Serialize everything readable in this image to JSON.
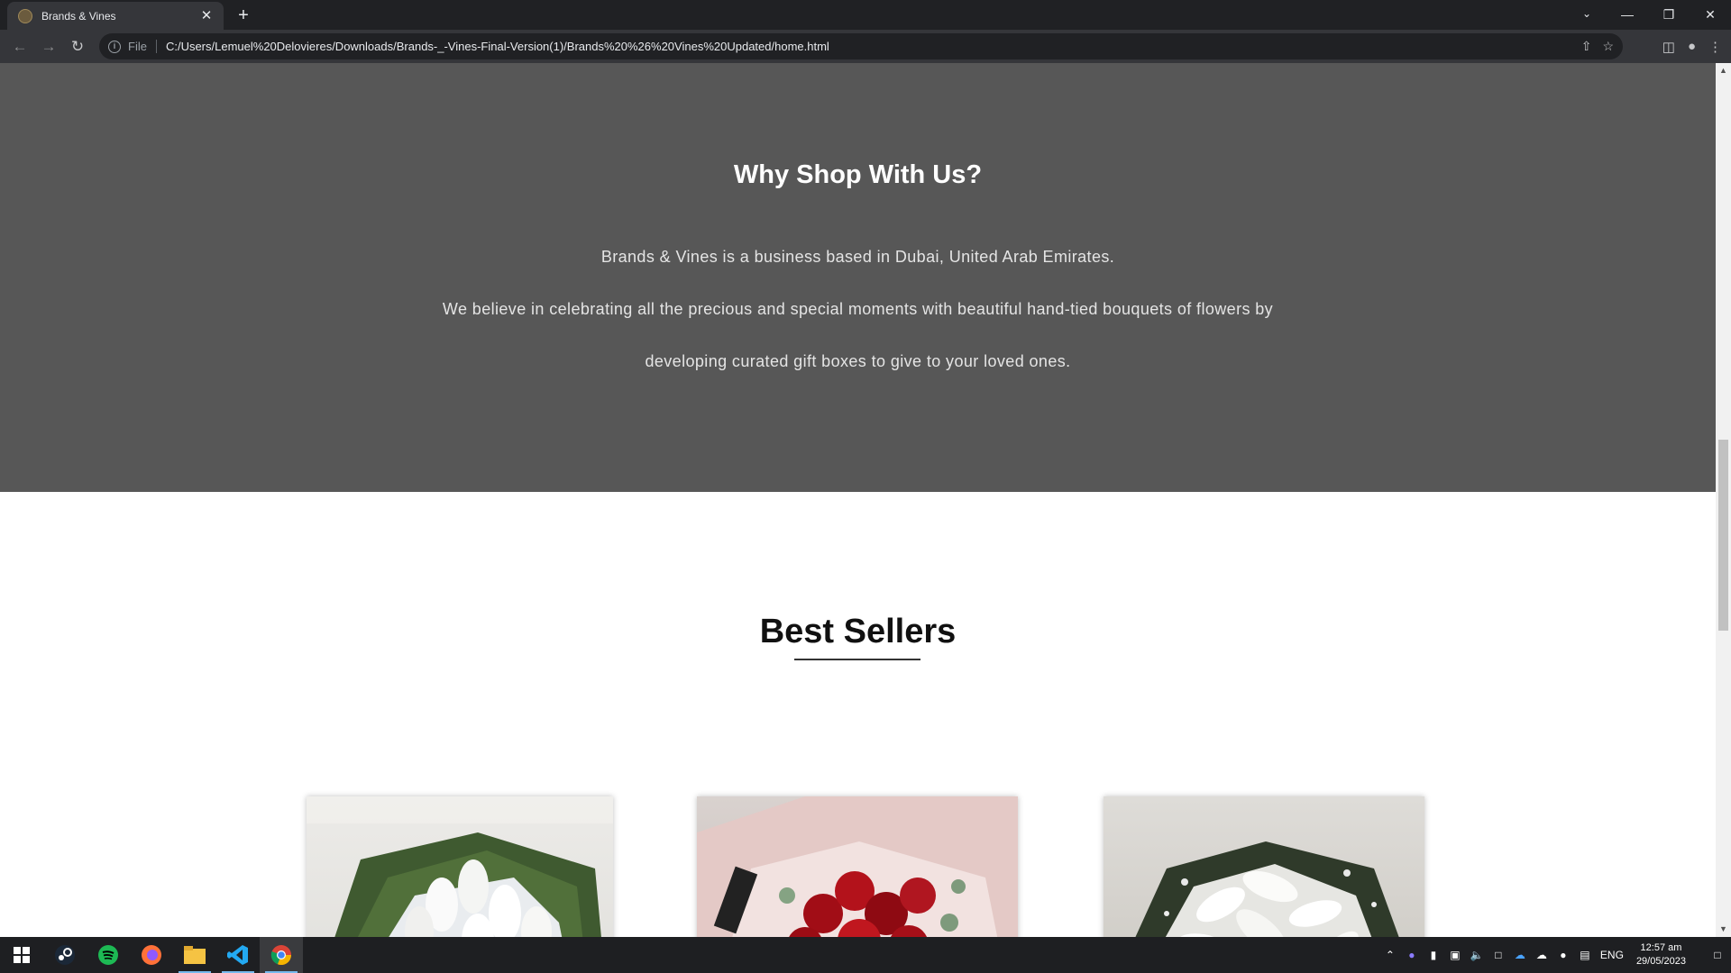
{
  "browser": {
    "tab_title": "Brands & Vines",
    "tab_close": "✕",
    "new_tab": "+",
    "scheme": "File",
    "url": "C:/Users/Lemuel%20Delovieres/Downloads/Brands-_-Vines-Final-Version(1)/Brands%20%26%20Vines%20Updated/home.html",
    "icons": [
      "back-arrow-icon",
      "forward-arrow-icon",
      "reload-icon",
      "info-icon",
      "share-icon",
      "star-icon",
      "sidebar-icon",
      "profile-icon",
      "menu-icon"
    ]
  },
  "page": {
    "why_title": "Why Shop With Us?",
    "why_p1": "Brands & Vines is a business based in Dubai, United Arab Emirates.",
    "why_p2": "We believe in celebrating all the precious and special moments with beautiful hand-tied bouquets of flowers by",
    "why_p3": "developing curated gift boxes to give to your loved ones.",
    "best_title": "Best Sellers",
    "colors": {
      "why_bg": "#575757",
      "page_bg": "#ffffff"
    }
  },
  "taskbar": {
    "apps": [
      "windows-start-icon",
      "steam-icon",
      "spotify-icon",
      "firefox-icon",
      "file-explorer-icon",
      "vscode-icon",
      "chrome-icon"
    ],
    "language": "ENG",
    "time": "12:57 am",
    "date": "29/05/2023"
  }
}
